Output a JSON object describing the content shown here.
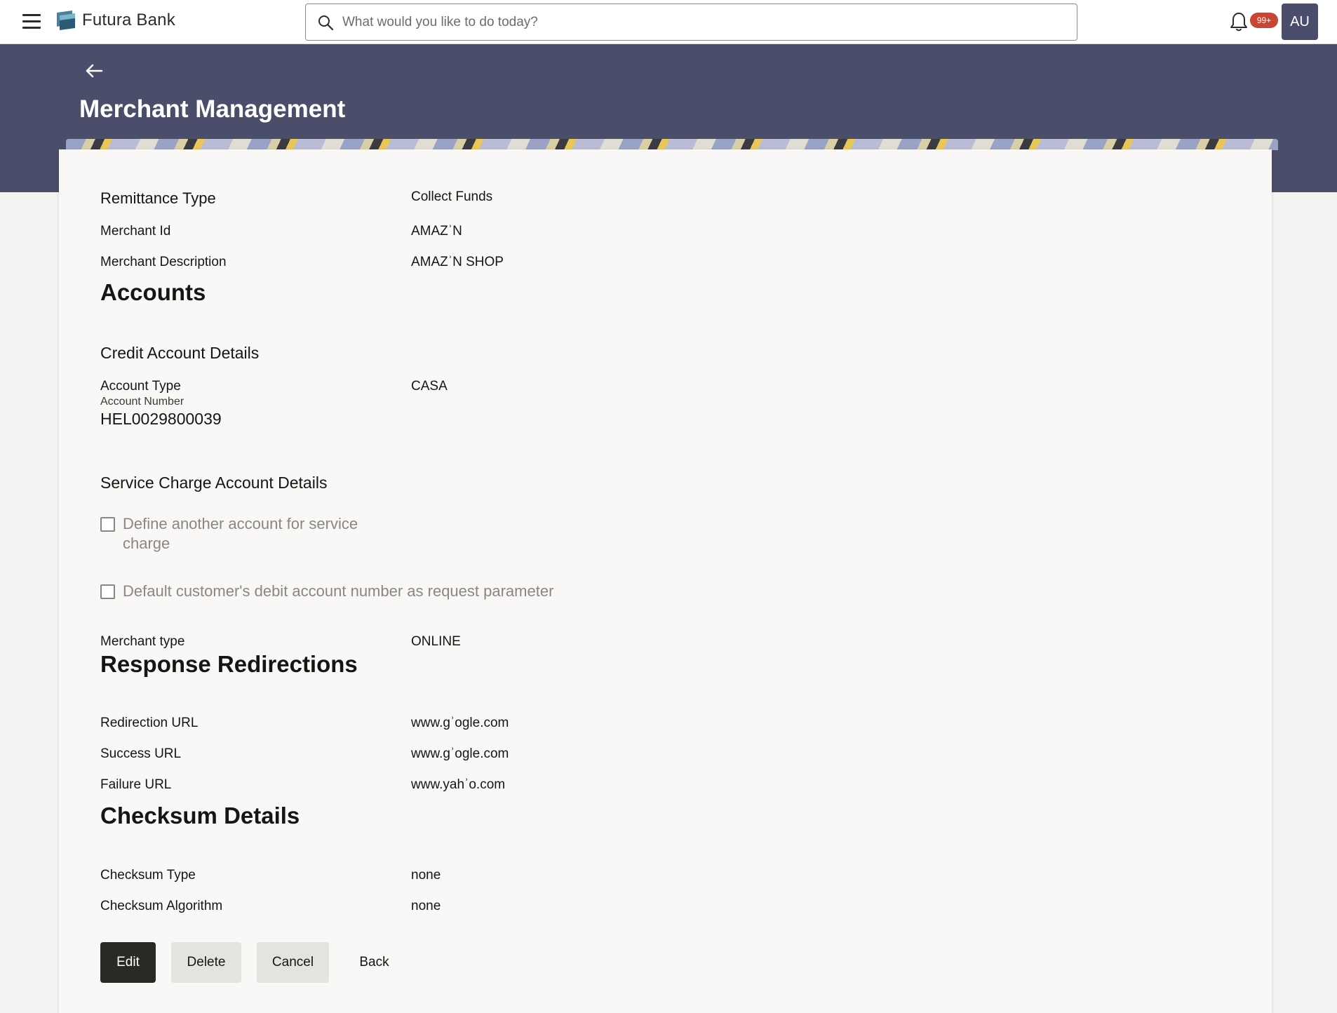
{
  "header": {
    "brand": "Futura Bank",
    "search_placeholder": "What would you like to do today?",
    "notifications_badge": "99+",
    "avatar_initials": "AU"
  },
  "page": {
    "title": "Merchant Management"
  },
  "details": {
    "remittance_type_label": "Remittance Type",
    "remittance_type_value": "Collect Funds",
    "merchant_id_label": "Merchant Id",
    "merchant_id_value": "AMAZʾN",
    "merchant_description_label": "Merchant Description",
    "merchant_description_value": "AMAZʾN SHOP"
  },
  "accounts": {
    "heading": "Accounts",
    "credit_heading": "Credit Account Details",
    "account_type_label": "Account Type",
    "account_type_value": "CASA",
    "account_number_label": "Account Number",
    "account_number_value": "HEL0029800039",
    "service_charge_heading": "Service Charge Account Details",
    "checkbox_service_charge": "Define another account for service charge",
    "checkbox_default_debit": "Default customer's debit account number as request parameter",
    "merchant_type_label": "Merchant type",
    "merchant_type_value": "ONLINE"
  },
  "redirections": {
    "heading": "Response Redirections",
    "redirection_url_label": "Redirection URL",
    "redirection_url_value": "www.gʾogle.com",
    "success_url_label": "Success URL",
    "success_url_value": "www.gʾogle.com",
    "failure_url_label": "Failure URL",
    "failure_url_value": "www.yahʾo.com"
  },
  "checksum": {
    "heading": "Checksum Details",
    "type_label": "Checksum Type",
    "type_value": "none",
    "algorithm_label": "Checksum Algorithm",
    "algorithm_value": "none"
  },
  "actions": {
    "edit": "Edit",
    "delete": "Delete",
    "cancel": "Cancel",
    "back": "Back"
  },
  "colors": {
    "header_band": "#4a4e6b",
    "primary_button": "#2a2926",
    "badge": "#c74634"
  }
}
